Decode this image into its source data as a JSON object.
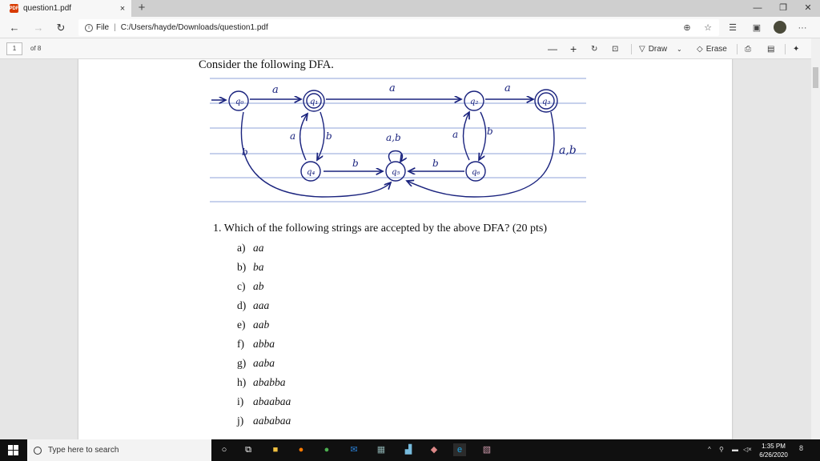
{
  "browser": {
    "tab_title": "question1.pdf",
    "tab_close": "×",
    "new_tab": "+",
    "minimize": "—",
    "maximize": "❐",
    "close": "✕",
    "url_scheme": "File",
    "url_path": "C:/Users/hayde/Downloads/question1.pdf",
    "more": "···"
  },
  "pdf_toolbar": {
    "page_number": "1",
    "page_of": "of 8",
    "zoom_out": "—",
    "zoom_in": "+",
    "draw_label": "Draw",
    "erase_label": "Erase"
  },
  "document": {
    "intro": "Consider the following DFA.",
    "dfa": {
      "states": [
        "q0",
        "q1",
        "q2",
        "q3",
        "q4",
        "q5",
        "q6"
      ],
      "start_state": "q0",
      "accept_states": [
        "q1",
        "q3"
      ],
      "labels": [
        "a",
        "a",
        "a",
        "b",
        "a",
        "a,b",
        "a",
        "b",
        "b",
        "b",
        "a,b"
      ]
    },
    "question": "1.  Which of the following strings are accepted by the above DFA? (20 pts)",
    "options": [
      {
        "label": "a)",
        "text": "aa"
      },
      {
        "label": "b)",
        "text": "ba"
      },
      {
        "label": "c)",
        "text": "ab"
      },
      {
        "label": "d)",
        "text": "aaa"
      },
      {
        "label": "e)",
        "text": "aab"
      },
      {
        "label": "f)",
        "text": "abba"
      },
      {
        "label": "g)",
        "text": "aaba"
      },
      {
        "label": "h)",
        "text": "ababba"
      },
      {
        "label": "i)",
        "text": "abaabaa"
      },
      {
        "label": "j)",
        "text": "aababaa"
      }
    ]
  },
  "taskbar": {
    "search_placeholder": "Type here to search",
    "time": "1:35 PM",
    "date": "6/26/2020",
    "notification_count": "8"
  }
}
